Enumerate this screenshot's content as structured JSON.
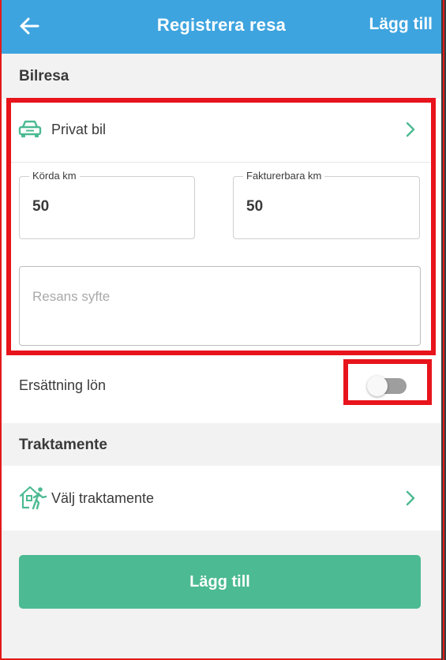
{
  "header": {
    "title": "Registrera resa",
    "action_label": "Lägg till",
    "back_icon": "arrow-left-icon"
  },
  "bilresa": {
    "section_title": "Bilresa",
    "vehicle_label": "Privat bil",
    "vehicle_icon": "car-icon",
    "driven_km": {
      "label": "Körda km",
      "value": "50"
    },
    "billable_km": {
      "label": "Fakturerbara km",
      "value": "50"
    },
    "purpose_placeholder": "Resans syfte"
  },
  "salary_compensation": {
    "label": "Ersättning lön",
    "enabled": false
  },
  "traktamente": {
    "section_title": "Traktamente",
    "select_label": "Välj traktamente",
    "select_icon": "house-walking-person-icon"
  },
  "submit_label": "Lägg till",
  "colors": {
    "header": "#3ea4df",
    "accent": "#4cba92",
    "highlight": "#e8141c",
    "section_bg": "#f2f2f2"
  }
}
